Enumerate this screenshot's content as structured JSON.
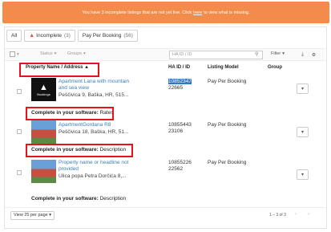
{
  "banner": {
    "text_before": "You have 3 incomplete listings that are not yet live. Click",
    "link": "here",
    "text_after": "to view what is missing."
  },
  "tabs": [
    {
      "label": "All"
    },
    {
      "label": "Incomplete",
      "count": "(3)"
    },
    {
      "label": "Pay Per Booking",
      "count": "(56)"
    }
  ],
  "toolbar": {
    "status": "Status",
    "groups": "Groups",
    "search_placeholder": "HA ID / ID",
    "filter": "Filter"
  },
  "table": {
    "headers": {
      "property": "Property Name / Address ▲",
      "haid": "HA ID / ID",
      "model": "Listing Model",
      "group": "Group"
    },
    "rows": [
      {
        "name": "Apartment Lana with mountain and sea view",
        "address": "Peščivica 9, Baška, HR, 515...",
        "ha_id": "10852347",
        "id": "22665",
        "model": "Pay Per Booking",
        "complete_label": "Complete in your software:",
        "complete_value": "Rates",
        "thumb_text": "Bookings"
      },
      {
        "name": "ApartmentGordana R8",
        "address": "Peščivica 18, Baška, HR, 51...",
        "ha_id": "10855443",
        "id": "23106",
        "model": "Pay Per Booking",
        "complete_label": "Complete in your software:",
        "complete_value": "Description"
      },
      {
        "name": "Property name or headline not provided",
        "address": "Ulica popa Petra Dorčića 8,...",
        "ha_id": "10855226",
        "id": "22562",
        "model": "Pay Per Booking",
        "complete_label": "Complete in your software:",
        "complete_value": "Description"
      }
    ]
  },
  "footer": {
    "page_size": "View 25 per page",
    "page_info": "1 – 3 of 3"
  },
  "colors": {
    "banner": "#f38b4a",
    "link": "#3b7fc4",
    "highlight": "#e5141b"
  }
}
